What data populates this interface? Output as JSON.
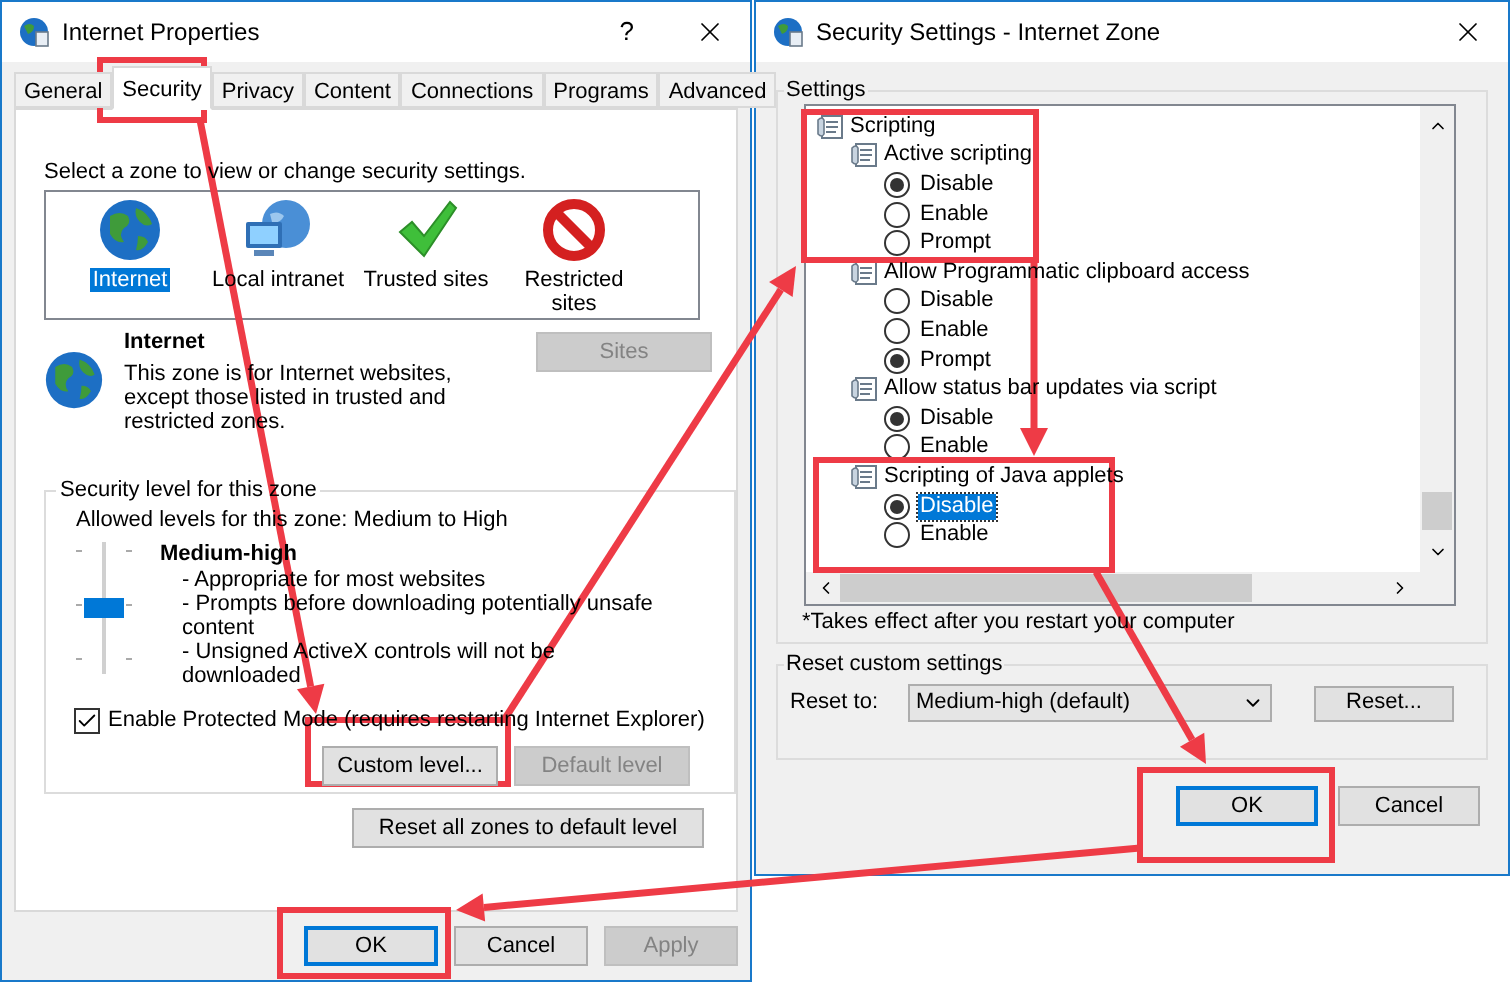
{
  "internet_properties": {
    "title": "Internet Properties",
    "help_label": "?",
    "tabs": [
      {
        "label": "General",
        "selected": false
      },
      {
        "label": "Security",
        "selected": true
      },
      {
        "label": "Privacy",
        "selected": false
      },
      {
        "label": "Content",
        "selected": false
      },
      {
        "label": "Connections",
        "selected": false
      },
      {
        "label": "Programs",
        "selected": false
      },
      {
        "label": "Advanced",
        "selected": false
      }
    ],
    "zone_prompt": "Select a zone to view or change security settings.",
    "zones": [
      {
        "kind": "internet",
        "label": "Internet",
        "selected": true
      },
      {
        "kind": "intranet",
        "label": "Local intranet",
        "selected": false
      },
      {
        "kind": "trusted",
        "label": "Trusted sites",
        "selected": false
      },
      {
        "kind": "restricted",
        "label": "Restricted sites",
        "selected": false
      }
    ],
    "zone_info": {
      "name": "Internet",
      "description": "This zone is for Internet websites, except those listed in trusted and restricted zones."
    },
    "sites_button": {
      "label": "Sites",
      "disabled": true
    },
    "security_level": {
      "group_label": "Security level for this zone",
      "allowed_levels": "Allowed levels for this zone: Medium to High",
      "level": 0.5,
      "level_name": "Medium-high",
      "details": [
        "- Appropriate for most websites",
        "- Prompts before downloading potentially unsafe content",
        "- Unsigned ActiveX controls will not be downloaded"
      ],
      "protected_mode": {
        "label": "Enable Protected Mode (requires restarting Internet Explorer)",
        "checked": true
      },
      "custom_level_button": {
        "label": "Custom level...",
        "disabled": false
      },
      "default_level_button": {
        "label": "Default level",
        "disabled": true
      }
    },
    "reset_all_button": "Reset all zones to default level",
    "buttons": [
      {
        "label": "OK",
        "disabled": false,
        "focused": true
      },
      {
        "label": "Cancel",
        "disabled": false,
        "focused": false
      },
      {
        "label": "Apply",
        "disabled": true,
        "focused": false
      }
    ]
  },
  "security_settings": {
    "title": "Security Settings - Internet Zone",
    "settings_label": "Settings",
    "settings_tree": [
      {
        "kind": "category",
        "label": "Scripting",
        "children": [
          {
            "kind": "setting",
            "label": "Active scripting",
            "children": [
              {
                "kind": "option",
                "label": "Disable",
                "selected": true,
                "focused": false
              },
              {
                "kind": "option",
                "label": "Enable",
                "selected": false,
                "focused": false
              },
              {
                "kind": "option",
                "label": "Prompt",
                "selected": false,
                "focused": false
              }
            ]
          },
          {
            "kind": "setting",
            "label": "Allow Programmatic clipboard access",
            "children": [
              {
                "kind": "option",
                "label": "Disable",
                "selected": false,
                "focused": false
              },
              {
                "kind": "option",
                "label": "Enable",
                "selected": false,
                "focused": false
              },
              {
                "kind": "option",
                "label": "Prompt",
                "selected": true,
                "focused": false
              }
            ]
          },
          {
            "kind": "setting",
            "label": "Allow status bar updates via script",
            "children": [
              {
                "kind": "option",
                "label": "Disable",
                "selected": true,
                "focused": false
              },
              {
                "kind": "option",
                "label": "Enable",
                "selected": false,
                "focused": false
              }
            ]
          },
          {
            "kind": "setting",
            "label": "Scripting of Java applets",
            "children": [
              {
                "kind": "option",
                "label": "Disable",
                "selected": true,
                "focused": true
              },
              {
                "kind": "option",
                "label": "Enable",
                "selected": false,
                "focused": false
              }
            ]
          }
        ]
      }
    ],
    "footnote": "*Takes effect after you restart your computer",
    "reset_group_label": "Reset custom settings",
    "reset_to_label": "Reset to:",
    "reset_to_value": "Medium-high (default)",
    "reset_button": "Reset...",
    "buttons": [
      {
        "label": "OK",
        "disabled": false,
        "focused": true
      },
      {
        "label": "Cancel",
        "disabled": false,
        "focused": false
      }
    ]
  }
}
